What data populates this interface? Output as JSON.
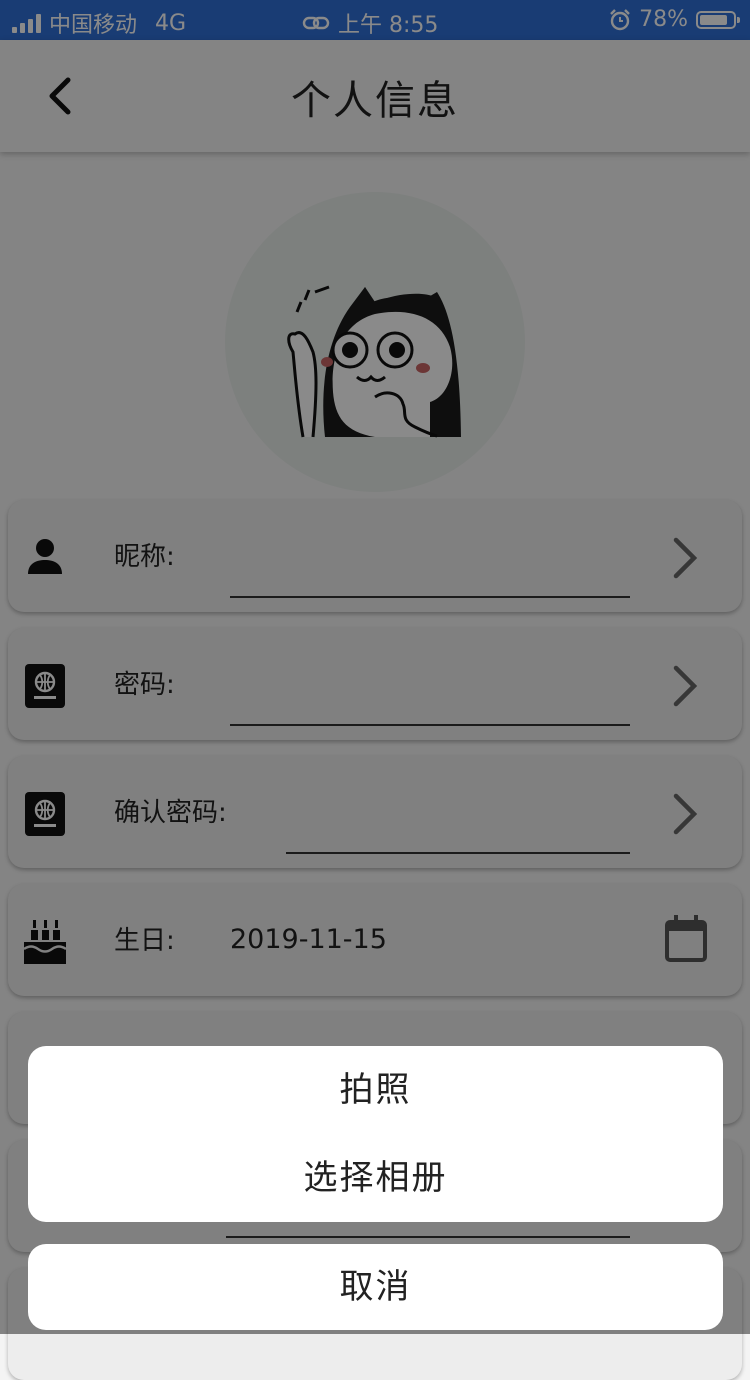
{
  "status_bar": {
    "carrier": "中国移动",
    "network": "4G",
    "time": "上午 8:55",
    "battery": "78%"
  },
  "header": {
    "title": "个人信息",
    "back_icon": "chevron-left-icon"
  },
  "avatar": {
    "image": "cat-sticker-avatar"
  },
  "form": {
    "rows": [
      {
        "label": "昵称:",
        "icon": "person-icon",
        "value": "",
        "action_icon": "chevron-right-icon"
      },
      {
        "label": "密码:",
        "icon": "passport-icon",
        "value": "",
        "action_icon": "chevron-right-icon"
      },
      {
        "label": "确认密码:",
        "icon": "passport-icon",
        "value": "",
        "action_icon": "chevron-right-icon"
      },
      {
        "label": "生日:",
        "icon": "cake-icon",
        "value": "2019-11-15",
        "action_icon": "calendar-icon"
      }
    ]
  },
  "action_sheet": {
    "options": [
      "拍照",
      "选择相册"
    ],
    "cancel": "取消"
  },
  "colors": {
    "status_bar": "#2f6fd6",
    "overlay": "rgba(0,0,0,0.46)"
  }
}
